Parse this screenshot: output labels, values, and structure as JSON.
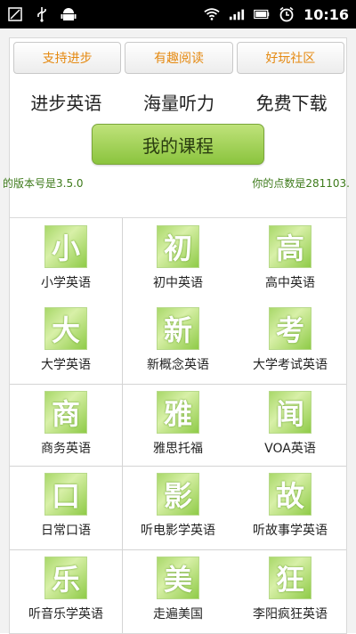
{
  "status_bar": {
    "time": "10:16",
    "icons": [
      "notification-icon",
      "usb-icon",
      "android-icon",
      "wifi-icon",
      "signal-icon",
      "battery-icon",
      "alarm-icon"
    ]
  },
  "tabs": [
    {
      "label": "支持进步"
    },
    {
      "label": "有趣阅读"
    },
    {
      "label": "好玩社区"
    }
  ],
  "slogan": [
    "进步英语",
    "海量听力",
    "免费下载"
  ],
  "my_course_button": "我的课程",
  "version_text": "的版本号是3.5.0",
  "points_text": "你的点数是281103.",
  "courses": [
    {
      "char": "小",
      "label": "小学英语"
    },
    {
      "char": "初",
      "label": "初中英语"
    },
    {
      "char": "高",
      "label": "高中英语"
    },
    {
      "char": "大",
      "label": "大学英语"
    },
    {
      "char": "新",
      "label": "新概念英语"
    },
    {
      "char": "考",
      "label": "大学考试英语"
    },
    {
      "char": "商",
      "label": "商务英语"
    },
    {
      "char": "雅",
      "label": "雅思托福"
    },
    {
      "char": "闻",
      "label": "VOA英语"
    },
    {
      "char": "口",
      "label": "日常口语"
    },
    {
      "char": "影",
      "label": "听电影学英语"
    },
    {
      "char": "故",
      "label": "听故事学英语"
    },
    {
      "char": "乐",
      "label": "听音乐学英语"
    },
    {
      "char": "美",
      "label": "走遍美国"
    },
    {
      "char": "狂",
      "label": "李阳疯狂英语"
    }
  ],
  "colors": {
    "accent_orange": "#e58a12",
    "button_green": "#8bc43e",
    "info_green": "#3d7a1a"
  }
}
